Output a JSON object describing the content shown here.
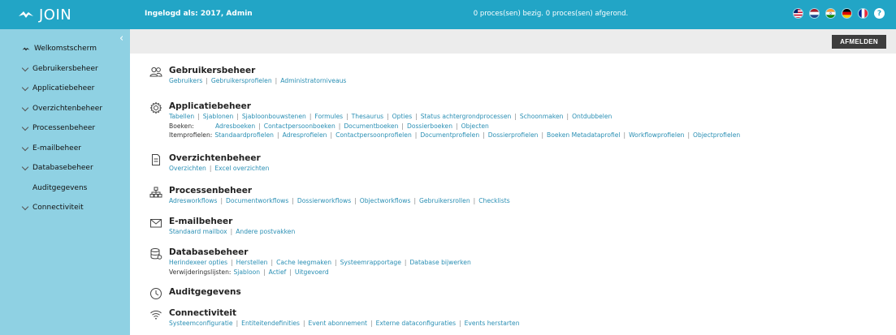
{
  "topbar": {
    "logo_text": "JOIN",
    "logged_in": "Ingelogd als: 2017, Admin",
    "processes": "0 proces(sen) bezig. 0 proces(sen) afgerond.",
    "help_label": "?"
  },
  "sidebar": {
    "collapse_glyph": "‹",
    "items": [
      {
        "label": "Welkomstscherm"
      },
      {
        "label": "Gebruikersbeheer"
      },
      {
        "label": "Applicatiebeheer"
      },
      {
        "label": "Overzichtenbeheer"
      },
      {
        "label": "Processenbeheer"
      },
      {
        "label": "E-mailbeheer"
      },
      {
        "label": "Databasebeheer"
      },
      {
        "label": "Auditgegevens"
      },
      {
        "label": "Connectiviteit"
      }
    ]
  },
  "toolbar": {
    "logout_label": "AFMELDEN"
  },
  "sections": {
    "gebruikers": {
      "title": "Gebruikersbeheer",
      "links": [
        "Gebruikers",
        "Gebruikersprofielen",
        "Administratorniveaus"
      ]
    },
    "applicatie": {
      "title": "Applicatiebeheer",
      "links": [
        "Tabellen",
        "Sjablonen",
        "Sjabloonbouwstenen",
        "Formules",
        "Thesaurus",
        "Opties",
        "Status achtergrondprocessen",
        "Schoonmaken",
        "Ontdubbelen"
      ],
      "boeken_label": "Boeken:",
      "boeken": [
        "Adresboeken",
        "Contactpersoonboeken",
        "Documentboeken",
        "Dossierboeken",
        "Objecten"
      ],
      "itemprofielen_label": "Itemprofielen:",
      "itemprofielen": [
        "Standaardprofielen",
        "Adresprofielen",
        "Contactpersoonprofielen",
        "Documentprofielen",
        "Dossierprofielen",
        "Boeken Metadataprofiel",
        "Workflowprofielen",
        "Objectprofielen"
      ]
    },
    "overzichten": {
      "title": "Overzichtenbeheer",
      "links": [
        "Overzichten",
        "Excel overzichten"
      ]
    },
    "processen": {
      "title": "Processenbeheer",
      "links": [
        "Adresworkflows",
        "Documentworkflows",
        "Dossierworkflows",
        "Objectworkflows",
        "Gebruikersrollen",
        "Checklists"
      ]
    },
    "email": {
      "title": "E-mailbeheer",
      "links": [
        "Standaard mailbox",
        "Andere postvakken"
      ]
    },
    "database": {
      "title": "Databasebeheer",
      "links": [
        "Herindexeer opties",
        "Herstellen",
        "Cache leegmaken",
        "Systeemrapportage",
        "Database bijwerken"
      ],
      "verwijder_label": "Verwijderingslijsten:",
      "verwijder": [
        "Sjabloon",
        "Actief",
        "Uitgevoerd"
      ]
    },
    "audit": {
      "title": "Auditgegevens"
    },
    "connectiviteit": {
      "title": "Connectiviteit",
      "links": [
        "Systeemconfiguratie",
        "Entiteitendefinities",
        "Event abonnement",
        "Externe dataconfiguraties",
        "Events herstarten"
      ]
    }
  },
  "colors": {
    "topbar": "#22a5c6",
    "sidebar": "#8fd1e3",
    "link": "#2a8fb4",
    "logout": "#3d3d3d"
  }
}
